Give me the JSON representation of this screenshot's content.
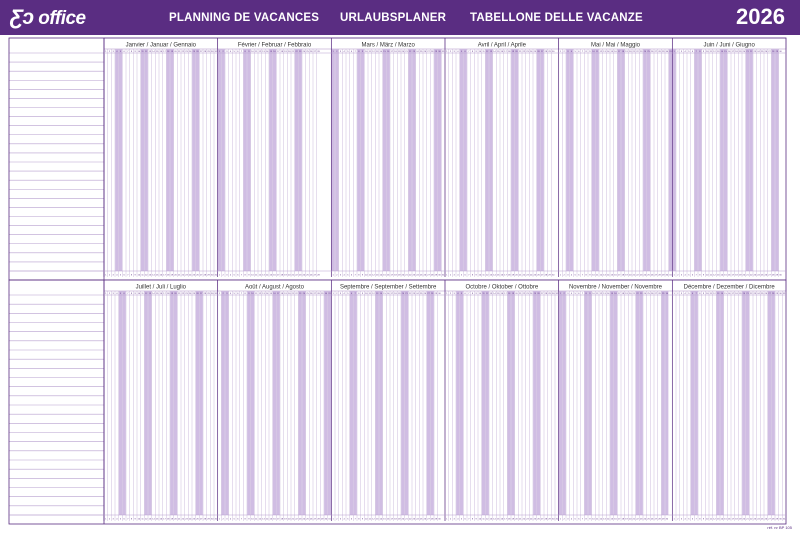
{
  "header": {
    "logo_mark": "Ƹɔ",
    "logo_text": "office",
    "title_fr": "PLANNING DE VACANCES",
    "title_de": "URLAUBSPLANER",
    "title_it": "TABELLONE DELLE VACANZE",
    "year": "2026"
  },
  "months": [
    {
      "label": "Janvier / Januar / Gennaio",
      "days": 31
    },
    {
      "label": "Février / Februar / Febbraio",
      "days": 28
    },
    {
      "label": "Mars / März / Marzo",
      "days": 31
    },
    {
      "label": "Avril / April / Aprile",
      "days": 30
    },
    {
      "label": "Mai / Mai / Maggio",
      "days": 31
    },
    {
      "label": "Juin / Juni / Giugno",
      "days": 30
    },
    {
      "label": "Juillet / Juli / Luglio",
      "days": 31
    },
    {
      "label": "Août / August / Agosto",
      "days": 31
    },
    {
      "label": "Septembre / September / Settembre",
      "days": 30
    },
    {
      "label": "Octobre / Oktober / Ottobre",
      "days": 31
    },
    {
      "label": "Novembre / November / Novembre",
      "days": 30
    },
    {
      "label": "Décembre / Dezember / Dicembre",
      "days": 31
    }
  ],
  "first_weekday_jan1": 3,
  "footer_ref": "réf. nr BP 105",
  "colors": {
    "brand": "#5a2d82",
    "grid": "#b79fcf",
    "weekend": "#c8b2de"
  }
}
